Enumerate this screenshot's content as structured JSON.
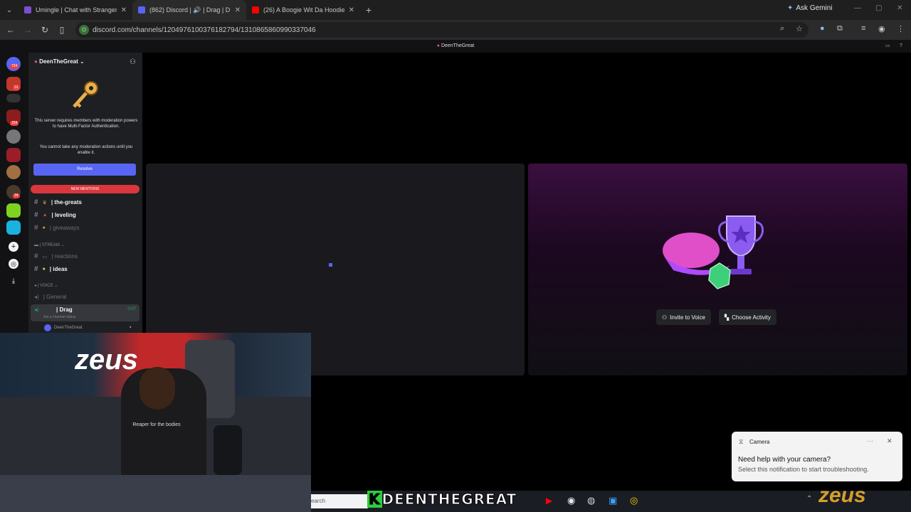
{
  "browser": {
    "tabs": [
      {
        "label": "Umingle | Chat with Strangers",
        "color": "#7b4fcf"
      },
      {
        "label": "(862) Discord | 🔊 | Drag | D",
        "color": "#5865f2"
      },
      {
        "label": "(26) A Boogie Wit Da Hoodie -",
        "color": "#ff0000"
      }
    ],
    "ask_gemini": "Ask Gemini",
    "url": "discord.com/channels/1204976100376182794/1310865860990337046"
  },
  "discord": {
    "window_title": "DeenTheGreat",
    "server_name": "DeenTheGreat",
    "mfa_message": "This server requires members with moderation powers to have Multi-Factor Authentication.",
    "mfa_sub": "You cannot take any moderation actions until you enable it.",
    "resolve_label": "Resolve",
    "new_mentions": "NEW MENTIONS",
    "channels": {
      "the_greats": "| the-greats",
      "leveling": "| leveling",
      "giveaways": "| giveaways",
      "stream_cat": "| STREAM",
      "reactions": "| reactions",
      "ideas": "| ideas",
      "voice_cat": "| VOICE",
      "general": "| General",
      "drag": "| Drag",
      "drag_time": "0:07",
      "drag_status": "Set a channel status",
      "member": "DeenTheGreat"
    },
    "rail_badges": [
      "724",
      "31",
      "154",
      "34"
    ],
    "invite_label": "Invite to Voice",
    "activity_label": "Choose Activity"
  },
  "overlay": {
    "k": "K",
    "name": "DEENTHEGREAT",
    "watermark": "zeus"
  },
  "taskbar": {
    "search": "earch"
  },
  "notification": {
    "app": "Camera",
    "title": "Need help with your camera?",
    "body": "Select this notification to start troubleshooting."
  },
  "webcam": {
    "shirt_text": "Reaper for the bodies",
    "banner": "zeus"
  }
}
